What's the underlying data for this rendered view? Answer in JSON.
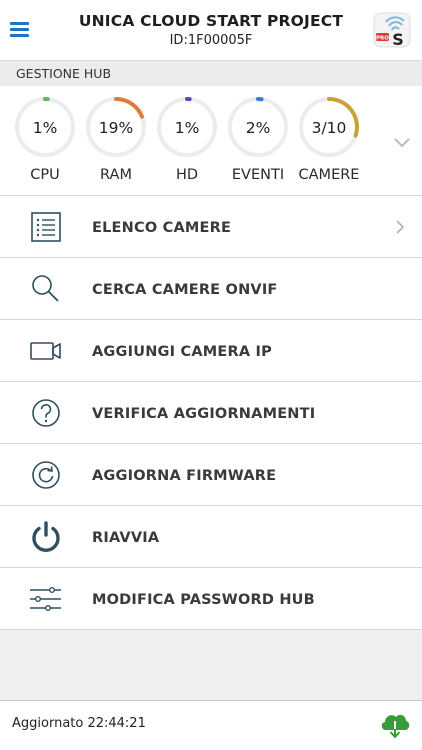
{
  "header": {
    "title": "UNICA CLOUD START PROJECT",
    "subtitle": "ID:1F00005F",
    "logo_badge": "PRO",
    "logo_letter": "S"
  },
  "section": {
    "title": "GESTIONE HUB"
  },
  "gauges": [
    {
      "key": "cpu",
      "label": "CPU",
      "value": "1%",
      "fraction": 0.01,
      "color": "#5cb85c"
    },
    {
      "key": "ram",
      "label": "RAM",
      "value": "19%",
      "fraction": 0.19,
      "color": "#e07a3f"
    },
    {
      "key": "hd",
      "label": "HD",
      "value": "1%",
      "fraction": 0.01,
      "color": "#4a4acb"
    },
    {
      "key": "eventi",
      "label": "EVENTI",
      "value": "2%",
      "fraction": 0.02,
      "color": "#2e7dd6"
    },
    {
      "key": "camere",
      "label": "CAMERE",
      "value": "3/10",
      "fraction": 0.3,
      "color": "#c9a23a"
    }
  ],
  "menu": [
    {
      "label": "ELENCO CAMERE",
      "icon": "list-icon",
      "chevron": true
    },
    {
      "label": "CERCA CAMERE ONVIF",
      "icon": "search-icon",
      "chevron": false
    },
    {
      "label": "AGGIUNGI CAMERA IP",
      "icon": "video-camera-icon",
      "chevron": false
    },
    {
      "label": "VERIFICA AGGIORNAMENTI",
      "icon": "question-icon",
      "chevron": false
    },
    {
      "label": "AGGIORNA FIRMWARE",
      "icon": "refresh-icon",
      "chevron": false
    },
    {
      "label": "RIAVVIA",
      "icon": "power-icon",
      "chevron": false
    },
    {
      "label": "MODIFICA PASSWORD HUB",
      "icon": "sliders-icon",
      "chevron": false
    }
  ],
  "footer": {
    "updated": "Aggiornato 22:44:21",
    "icon": "cloud-download-icon"
  },
  "colors": {
    "icon_dark": "#2f4f5e",
    "menu_blue": "#1f73c7",
    "cloud_green": "#3a9b3a"
  }
}
